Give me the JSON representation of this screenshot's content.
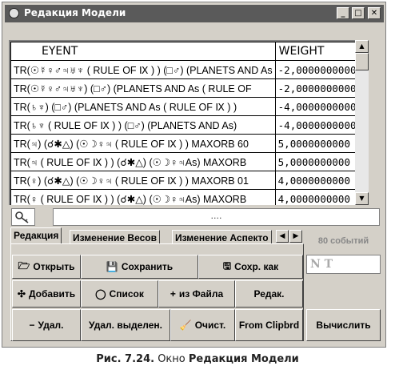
{
  "window": {
    "title": "Редакция Модели",
    "buttons": [
      "_",
      "□",
      "✕"
    ]
  },
  "grid": {
    "columns": [
      "EYENT",
      "WEIGHT"
    ],
    "rows": [
      {
        "event": "TR(☉☿♀♂♃♅♆ ( RULE OF Ⅸ ) ) (□♂) (PLANETS AND As",
        "weight": "-2,0000000000"
      },
      {
        "event": "TR(☉☿♀♂♃♅♆) (□♂) (PLANETS AND As ( RULE OF",
        "weight": "-2,0000000000"
      },
      {
        "event": "TR(♄♆) (□♂) (PLANETS AND As ( RULE OF Ⅸ ) )",
        "weight": "-4,0000000000"
      },
      {
        "event": "TR(♄♆ ( RULE OF Ⅸ ) ) (□♂) (PLANETS AND As)",
        "weight": "-4,0000000000"
      },
      {
        "event": "TR(♃) (☌✱△) (☉☽♀♃ ( RULE OF Ⅸ ) ) MAXORB 60",
        "weight": "5,0000000000"
      },
      {
        "event": "TR(♃ ( RULE OF Ⅸ ) ) (☌✱△) (☉☽♀♃As) MAXORB",
        "weight": "5,0000000000"
      },
      {
        "event": "TR(♀) (☌✱△) (☉☽♀♃ ( RULE OF Ⅸ ) ) MAXORB 01",
        "weight": "4,0000000000"
      },
      {
        "event": "TR(♀ ( RULE OF Ⅸ ) ) (☌✱△) (☉☽♀♃As) MAXORB",
        "weight": "4,0000000000"
      }
    ]
  },
  "editor": {
    "value": "...."
  },
  "tabs": [
    "Редакция",
    "Изменение Весов",
    "Изменение Аспекто"
  ],
  "buttons": {
    "open": "Открыть",
    "save": "Сохранить",
    "save_as": "Сохр. как",
    "add": "Добавить",
    "list": "Список",
    "from_file": "из Файла",
    "edit": "Редак.",
    "delete": "Удал.",
    "delete_selected": "Удал. выделен.",
    "clear": "Очист.",
    "from_clipboard": "From Clipbrd",
    "calculate": "Вычислить"
  },
  "status": {
    "events": "80 событий",
    "nt": "N T"
  },
  "caption": {
    "label": "Рис. 7.24.",
    "text": "Окно",
    "name": "Редакция Модели"
  }
}
